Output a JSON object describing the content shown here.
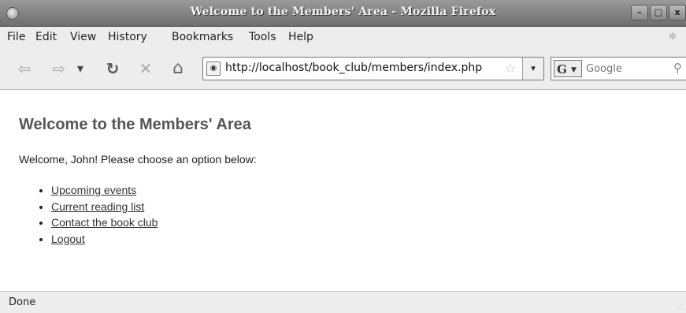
{
  "window": {
    "title": "Welcome to the Members' Area - Mozilla Firefox",
    "controls": {
      "minimize": "–",
      "maximize": "□",
      "close": "x"
    }
  },
  "menubar": {
    "items": [
      "File",
      "Edit",
      "View",
      "History",
      "Bookmarks",
      "Tools",
      "Help"
    ]
  },
  "toolbar": {
    "back_icon": "⇦",
    "forward_icon": "⇨",
    "history_dropdown_icon": "▾",
    "reload_icon": "↻",
    "stop_icon": "✕",
    "home_icon": "⌂",
    "url": "http://localhost/book_club/members/index.php",
    "bookmark_star": "☆",
    "url_dropdown_icon": "▾",
    "search_engine": "G",
    "search_placeholder": "Google",
    "search_icon": "🔍"
  },
  "page": {
    "heading": "Welcome to the Members' Area",
    "intro": "Welcome, John! Please choose an option below:",
    "links": [
      "Upcoming events",
      "Current reading list",
      "Contact the book club",
      "Logout"
    ]
  },
  "statusbar": {
    "text": "Done"
  }
}
